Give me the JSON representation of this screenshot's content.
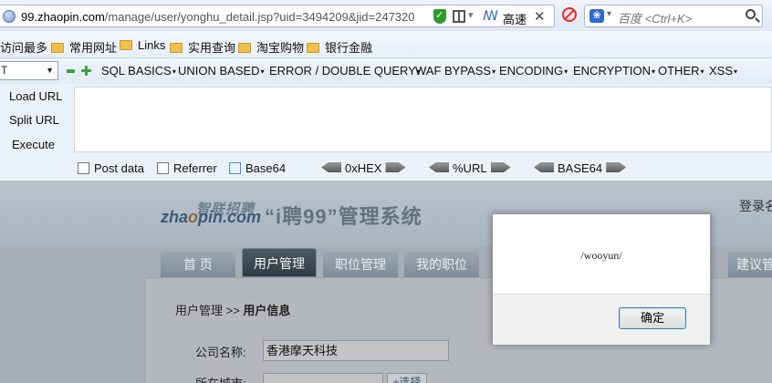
{
  "browser": {
    "url_host": "99.zhaopin.com",
    "url_path": "/manage/user/yonghu_detail.jsp?uid=3494209&jid=247320",
    "speed_label": "高速",
    "search_placeholder": "百度 <Ctrl+K>"
  },
  "bookmarks": [
    "访问最多",
    "常用网址",
    "Links",
    "实用查询",
    "淘宝购物",
    "银行金融"
  ],
  "hackbar": {
    "select_value": "T",
    "menus": [
      "SQL BASICS",
      "UNION BASED",
      "ERROR / DOUBLE QUERY",
      "WAF BYPASS",
      "ENCODING",
      "ENCRYPTION",
      "OTHER",
      "XSS"
    ],
    "load_url": "Load URL",
    "split_url": "Split URL",
    "execute": "Execute",
    "post_data": "Post data",
    "referrer": "Referrer",
    "base64_check": "Base64",
    "hex": "0xHEX",
    "url_enc": "%URL",
    "base64_enc": "BASE64"
  },
  "site": {
    "logo_cn": "智联招聘",
    "logo_en_prefix": "zha",
    "logo_en_o": "o",
    "logo_en_suffix": "pin.com",
    "system_title": "“i聘99”管理系统",
    "login_text": "登录名",
    "tabs": [
      "首 页",
      "用户管理",
      "职位管理",
      "我的职位",
      "建议管"
    ],
    "breadcrumb_parent": "用户管理 >> ",
    "breadcrumb_current": "用户信息",
    "company_label": "公司名称:",
    "company_value": "香港摩天科技",
    "city_label": "所在城市:",
    "pick_button": "+选择"
  },
  "dialog": {
    "message": "/wooyun/",
    "ok_label": "确定"
  }
}
